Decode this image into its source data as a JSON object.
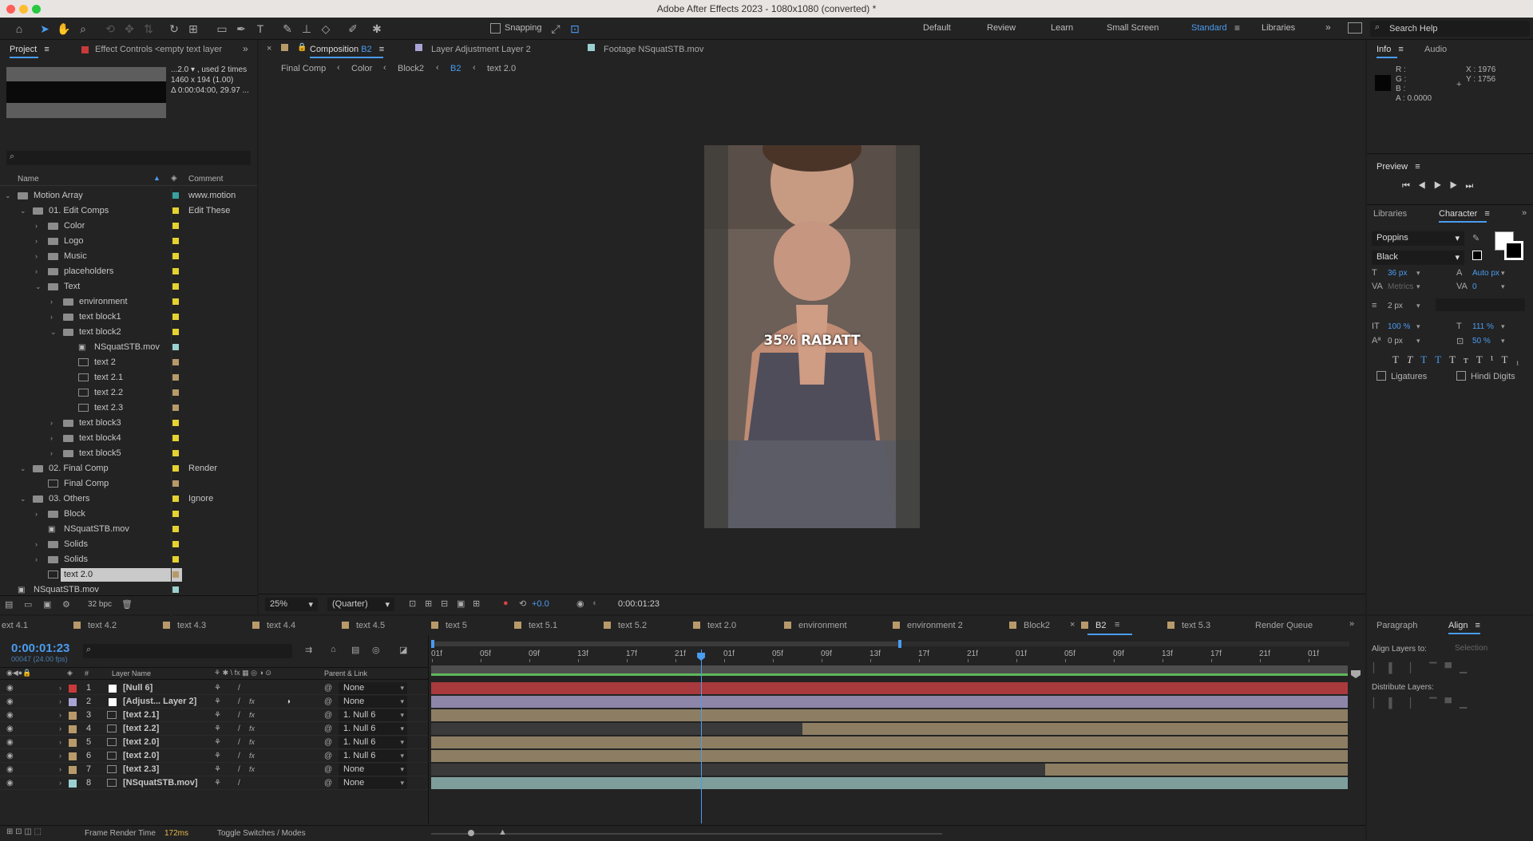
{
  "window": {
    "title": "Adobe After Effects 2023 - 1080x1080 (converted) *"
  },
  "toolbar": {
    "snapping_label": "Snapping",
    "workspaces": [
      "Default",
      "Review",
      "Learn",
      "Small Screen",
      "Standard",
      "Libraries"
    ],
    "active_workspace": "Standard",
    "search_placeholder": "Search Help"
  },
  "project_panel": {
    "tab_project": "Project",
    "tab_effect_controls": "Effect Controls <empty text layer",
    "thumb_info_line1": "...2.0 ▾ , used 2 times",
    "thumb_info_line2": "1460 x 194 (1.00)",
    "thumb_info_line3": "Δ 0:00:04:00, 29.97 ...",
    "search_placeholder": "",
    "col_name": "Name",
    "col_comment": "Comment",
    "bpc": "32 bpc",
    "items": [
      {
        "name": "Motion Array",
        "comment": "www.motion",
        "type": "folder",
        "indent": 0,
        "open": true,
        "label": "#3ba0a0"
      },
      {
        "name": "01. Edit Comps",
        "comment": "Edit These",
        "type": "folder",
        "indent": 1,
        "open": true,
        "label": "#e6d230"
      },
      {
        "name": "Color",
        "comment": "",
        "type": "folder",
        "indent": 2,
        "open": false,
        "label": "#e6d230"
      },
      {
        "name": "Logo",
        "comment": "",
        "type": "folder",
        "indent": 2,
        "open": false,
        "label": "#e6d230"
      },
      {
        "name": "Music",
        "comment": "",
        "type": "folder",
        "indent": 2,
        "open": false,
        "label": "#e6d230"
      },
      {
        "name": "placeholders",
        "comment": "",
        "type": "folder",
        "indent": 2,
        "open": false,
        "label": "#e6d230"
      },
      {
        "name": "Text",
        "comment": "",
        "type": "folder",
        "indent": 2,
        "open": true,
        "label": "#e6d230"
      },
      {
        "name": "environment",
        "comment": "",
        "type": "folder",
        "indent": 3,
        "open": false,
        "label": "#e6d230"
      },
      {
        "name": "text block1",
        "comment": "",
        "type": "folder",
        "indent": 3,
        "open": false,
        "label": "#e6d230"
      },
      {
        "name": "text block2",
        "comment": "",
        "type": "folder",
        "indent": 3,
        "open": true,
        "label": "#e6d230"
      },
      {
        "name": "NSquatSTB.mov",
        "comment": "",
        "type": "footage",
        "indent": 4,
        "open": null,
        "label": "#9ad0d0"
      },
      {
        "name": "text 2",
        "comment": "",
        "type": "comp",
        "indent": 4,
        "open": null,
        "label": "#b89a6a"
      },
      {
        "name": "text 2.1",
        "comment": "",
        "type": "comp",
        "indent": 4,
        "open": null,
        "label": "#b89a6a"
      },
      {
        "name": "text 2.2",
        "comment": "",
        "type": "comp",
        "indent": 4,
        "open": null,
        "label": "#b89a6a"
      },
      {
        "name": "text 2.3",
        "comment": "",
        "type": "comp",
        "indent": 4,
        "open": null,
        "label": "#b89a6a"
      },
      {
        "name": "text block3",
        "comment": "",
        "type": "folder",
        "indent": 3,
        "open": false,
        "label": "#e6d230"
      },
      {
        "name": "text block4",
        "comment": "",
        "type": "folder",
        "indent": 3,
        "open": false,
        "label": "#e6d230"
      },
      {
        "name": "text block5",
        "comment": "",
        "type": "folder",
        "indent": 3,
        "open": false,
        "label": "#e6d230"
      },
      {
        "name": "02. Final Comp",
        "comment": "Render",
        "type": "folder",
        "indent": 1,
        "open": true,
        "label": "#e6d230"
      },
      {
        "name": "Final Comp",
        "comment": "",
        "type": "comp",
        "indent": 2,
        "open": null,
        "label": "#b89a6a"
      },
      {
        "name": "03. Others",
        "comment": "Ignore",
        "type": "folder",
        "indent": 1,
        "open": true,
        "label": "#e6d230"
      },
      {
        "name": "Block",
        "comment": "",
        "type": "folder",
        "indent": 2,
        "open": false,
        "label": "#e6d230"
      },
      {
        "name": "NSquatSTB.mov",
        "comment": "",
        "type": "footage",
        "indent": 2,
        "open": null,
        "label": "#e6d230"
      },
      {
        "name": "Solids",
        "comment": "",
        "type": "folder",
        "indent": 2,
        "open": false,
        "label": "#e6d230"
      },
      {
        "name": "Solids",
        "comment": "",
        "type": "folder",
        "indent": 2,
        "open": false,
        "label": "#e6d230"
      },
      {
        "name": "text 2.0",
        "comment": "",
        "type": "comp",
        "indent": 2,
        "open": null,
        "label": "#b89a6a",
        "selected": true
      },
      {
        "name": "NSquatSTB.mov",
        "comment": "",
        "type": "footage",
        "indent": 0,
        "open": null,
        "label": "#9ad0d0"
      }
    ]
  },
  "comp_panel": {
    "tab_composition": "Composition",
    "tab_composition_name": "B2",
    "tab_layer": "Layer Adjustment Layer 2",
    "tab_footage": "Footage NSquatSTB.mov",
    "breadcrumbs": [
      "Final Comp",
      "Color",
      "Block2",
      "B2",
      "text 2.0"
    ],
    "active_crumb": "B2",
    "overlay_text": "35% RABATT",
    "zoom": "25%",
    "resolution": "(Quarter)",
    "exposure": "+0.0",
    "timecode": "0:00:01:23"
  },
  "info_panel": {
    "tab_info": "Info",
    "tab_audio": "Audio",
    "r": "R :",
    "g": "G :",
    "b": "B :",
    "a": "A : 0.0000",
    "x": "X : 1976",
    "y": "Y : 1756"
  },
  "preview_panel": {
    "title": "Preview"
  },
  "character_panel": {
    "tab_libraries": "Libraries",
    "tab_character": "Character",
    "font": "Poppins",
    "style": "Black",
    "size": "36 px",
    "leading": "Auto px",
    "kerning": "Metrics",
    "tracking": "0",
    "stroke": "2 px",
    "vscale": "100 %",
    "hscale": "111 %",
    "baseline": "0 px",
    "tsume": "50 %",
    "ligatures": "Ligatures",
    "hindi": "Hindi Digits",
    "accent_color": "#3b8ee5"
  },
  "timeline": {
    "tabs": [
      "ext 4.1",
      "text 4.2",
      "text 4.3",
      "text 4.4",
      "text 4.5",
      "text 5",
      "text 5.1",
      "text 5.2",
      "text 2.0",
      "environment",
      "environment 2",
      "Block2",
      "B2",
      "text 5.3",
      "Render Queue"
    ],
    "active_tab": "B2",
    "timecode": "0:00:01:23",
    "frame_info": "00047 (24.00 fps)",
    "col_layer_name": "Layer Name",
    "col_parent": "Parent & Link",
    "ruler": [
      "01f",
      "05f",
      "09f",
      "13f",
      "17f",
      "21f",
      "01f",
      "05f",
      "09f",
      "13f",
      "17f",
      "21f",
      "01f",
      "05f",
      "09f",
      "13f",
      "17f",
      "21f",
      "01f"
    ],
    "playhead_fraction": 0.294,
    "layers": [
      {
        "num": "1",
        "name": "[Null 6]",
        "parent": "None",
        "color": "#c83a3a",
        "bar_color": "#a8393d",
        "bar_start": 0.0,
        "fx": false
      },
      {
        "num": "2",
        "name": "[Adjust... Layer 2]",
        "parent": "None",
        "color": "#a9a4d6",
        "bar_color": "#8d86a9",
        "bar_start": 0.0,
        "fx": true
      },
      {
        "num": "3",
        "name": "[text 2.1]",
        "parent": "1. Null 6",
        "color": "#b89a6a",
        "bar_color": "#8d7e63",
        "bar_start": 0.0,
        "fx": true
      },
      {
        "num": "4",
        "name": "[text 2.2]",
        "parent": "1. Null 6",
        "color": "#b89a6a",
        "bar_color": "#8d7e63",
        "bar_start": 0.405,
        "fx": true
      },
      {
        "num": "5",
        "name": "[text 2.0]",
        "parent": "1. Null 6",
        "color": "#b89a6a",
        "bar_color": "#8d7e63",
        "bar_start": 0.0,
        "fx": true
      },
      {
        "num": "6",
        "name": "[text 2.0]",
        "parent": "1. Null 6",
        "color": "#b89a6a",
        "bar_color": "#8d7e63",
        "bar_start": 0.0,
        "fx": true
      },
      {
        "num": "7",
        "name": "[text 2.3]",
        "parent": "None",
        "color": "#b89a6a",
        "bar_color": "#8d7e63",
        "bar_start": 0.67,
        "fx": true
      },
      {
        "num": "8",
        "name": "[NSquatSTB.mov]",
        "parent": "None",
        "color": "#9ad0d0",
        "bar_color": "#7e9e9c",
        "bar_start": 0.0,
        "fx": false
      }
    ],
    "frame_render_label": "Frame Render Time",
    "frame_render_value": "172ms",
    "toggle_label": "Toggle Switches / Modes"
  },
  "align_panel": {
    "tab_paragraph": "Paragraph",
    "tab_align": "Align",
    "align_layers_to": "Align Layers to:",
    "selection": "Selection",
    "distribute": "Distribute Layers:"
  }
}
